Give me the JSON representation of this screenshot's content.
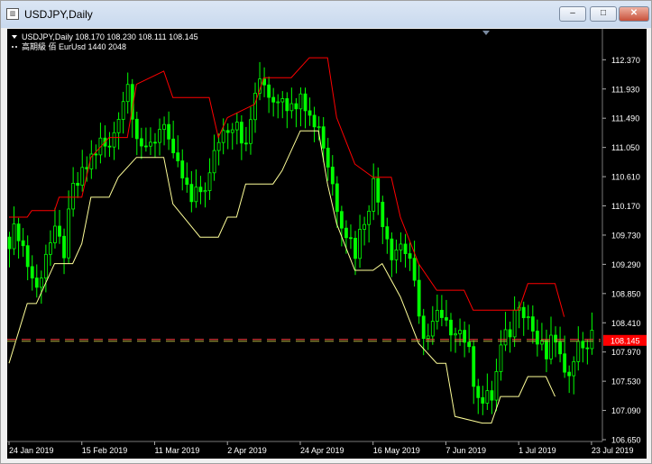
{
  "window": {
    "title": "USDJPY,Daily",
    "icon": "chart-window-icon",
    "minimize_label": "–",
    "maximize_label": "□",
    "close_label": "✕"
  },
  "indicator_lines": [
    "USDJPY,Daily  108.170 108.230 108.111 108.145",
    "高期級 佰 EurUsd 1440 2048"
  ],
  "colors": {
    "background": "#000000",
    "candles": "#00ff00",
    "upper_band": "#ff0000",
    "lower_band": "#ffff99",
    "price_badge": "#ff0000",
    "axis_text": "#ffffff"
  },
  "chart_data": {
    "type": "line",
    "symbol": "USDJPY",
    "timeframe": "Daily",
    "ohlc": {
      "open": 108.17,
      "high": 108.23,
      "low": 108.111,
      "close": 108.145
    },
    "current_price": 108.145,
    "current_price_label": "108.145",
    "ylim": [
      106.65,
      112.7
    ],
    "y_ticks": [
      "112.370",
      "111.930",
      "111.490",
      "111.050",
      "110.610",
      "110.170",
      "109.730",
      "109.290",
      "108.850",
      "108.410",
      "107.970",
      "107.530",
      "107.090",
      "106.650"
    ],
    "x_ticks": [
      "24 Jan 2019",
      "15 Feb 2019",
      "11 Mar 2019",
      "2 Apr 2019",
      "24 Apr 2019",
      "16 May 2019",
      "7 Jun 2019",
      "1 Jul 2019",
      "23 Jul 2019"
    ],
    "x_index_range": [
      0,
      130
    ],
    "x_tick_indices": [
      0,
      16,
      32,
      48,
      64,
      80,
      96,
      112,
      128
    ],
    "series": [
      {
        "key": "close",
        "points": [
          [
            0,
            109.7
          ],
          [
            2,
            109.8
          ],
          [
            4,
            109.3
          ],
          [
            6,
            108.9
          ],
          [
            8,
            109.5
          ],
          [
            10,
            109.7
          ],
          [
            12,
            109.5
          ],
          [
            14,
            110.4
          ],
          [
            16,
            110.6
          ],
          [
            18,
            110.9
          ],
          [
            20,
            111.1
          ],
          [
            22,
            111.0
          ],
          [
            24,
            111.6
          ],
          [
            26,
            112.0
          ],
          [
            28,
            111.3
          ],
          [
            30,
            110.9
          ],
          [
            32,
            111.2
          ],
          [
            34,
            111.5
          ],
          [
            36,
            110.8
          ],
          [
            38,
            110.6
          ],
          [
            40,
            110.2
          ],
          [
            42,
            110.4
          ],
          [
            44,
            110.6
          ],
          [
            46,
            111.2
          ],
          [
            48,
            111.4
          ],
          [
            50,
            111.5
          ],
          [
            52,
            111.0
          ],
          [
            54,
            111.9
          ],
          [
            56,
            112.0
          ],
          [
            58,
            111.8
          ],
          [
            60,
            111.9
          ],
          [
            62,
            111.6
          ],
          [
            64,
            112.0
          ],
          [
            66,
            111.5
          ],
          [
            68,
            111.4
          ],
          [
            70,
            110.8
          ],
          [
            72,
            110.2
          ],
          [
            74,
            109.8
          ],
          [
            76,
            109.5
          ],
          [
            78,
            110.0
          ],
          [
            80,
            110.5
          ],
          [
            82,
            110.0
          ],
          [
            84,
            109.5
          ],
          [
            86,
            109.6
          ],
          [
            88,
            109.4
          ],
          [
            90,
            108.4
          ],
          [
            92,
            108.2
          ],
          [
            94,
            108.5
          ],
          [
            96,
            108.3
          ],
          [
            98,
            108.4
          ],
          [
            100,
            108.2
          ],
          [
            102,
            107.6
          ],
          [
            104,
            107.2
          ],
          [
            106,
            107.3
          ],
          [
            108,
            108.0
          ],
          [
            110,
            108.3
          ],
          [
            112,
            108.8
          ],
          [
            114,
            108.5
          ],
          [
            116,
            108.1
          ],
          [
            118,
            107.9
          ],
          [
            120,
            108.2
          ],
          [
            122,
            107.5
          ],
          [
            124,
            108.0
          ],
          [
            126,
            108.1
          ],
          [
            128,
            108.145
          ]
        ]
      },
      {
        "key": "upper_band",
        "points": [
          [
            0,
            110.0
          ],
          [
            4,
            110.0
          ],
          [
            5,
            110.1
          ],
          [
            10,
            110.1
          ],
          [
            11,
            110.3
          ],
          [
            16,
            110.3
          ],
          [
            18,
            110.9
          ],
          [
            22,
            111.2
          ],
          [
            26,
            111.2
          ],
          [
            28,
            112.0
          ],
          [
            34,
            112.2
          ],
          [
            36,
            111.8
          ],
          [
            44,
            111.8
          ],
          [
            46,
            111.2
          ],
          [
            48,
            111.5
          ],
          [
            54,
            111.7
          ],
          [
            56,
            112.1
          ],
          [
            62,
            112.1
          ],
          [
            66,
            112.4
          ],
          [
            70,
            112.4
          ],
          [
            72,
            111.5
          ],
          [
            76,
            110.8
          ],
          [
            80,
            110.6
          ],
          [
            84,
            110.6
          ],
          [
            86,
            110.0
          ],
          [
            90,
            109.3
          ],
          [
            94,
            108.9
          ],
          [
            100,
            108.9
          ],
          [
            102,
            108.6
          ],
          [
            112,
            108.6
          ],
          [
            114,
            109.0
          ],
          [
            120,
            109.0
          ],
          [
            122,
            108.5
          ]
        ]
      },
      {
        "key": "lower_band",
        "points": [
          [
            0,
            107.8
          ],
          [
            4,
            108.7
          ],
          [
            6,
            108.7
          ],
          [
            10,
            109.3
          ],
          [
            14,
            109.3
          ],
          [
            16,
            109.6
          ],
          [
            18,
            110.3
          ],
          [
            22,
            110.3
          ],
          [
            24,
            110.6
          ],
          [
            28,
            110.9
          ],
          [
            34,
            110.9
          ],
          [
            36,
            110.2
          ],
          [
            42,
            109.7
          ],
          [
            46,
            109.7
          ],
          [
            48,
            110.0
          ],
          [
            50,
            110.0
          ],
          [
            52,
            110.5
          ],
          [
            58,
            110.5
          ],
          [
            60,
            110.7
          ],
          [
            64,
            111.3
          ],
          [
            68,
            111.3
          ],
          [
            70,
            110.5
          ],
          [
            72,
            109.9
          ],
          [
            76,
            109.2
          ],
          [
            80,
            109.2
          ],
          [
            82,
            109.3
          ],
          [
            86,
            108.8
          ],
          [
            90,
            108.1
          ],
          [
            94,
            107.8
          ],
          [
            96,
            107.8
          ],
          [
            98,
            107.0
          ],
          [
            104,
            106.9
          ],
          [
            106,
            106.9
          ],
          [
            108,
            107.3
          ],
          [
            112,
            107.3
          ],
          [
            114,
            107.6
          ],
          [
            118,
            107.6
          ],
          [
            120,
            107.3
          ]
        ]
      }
    ]
  }
}
